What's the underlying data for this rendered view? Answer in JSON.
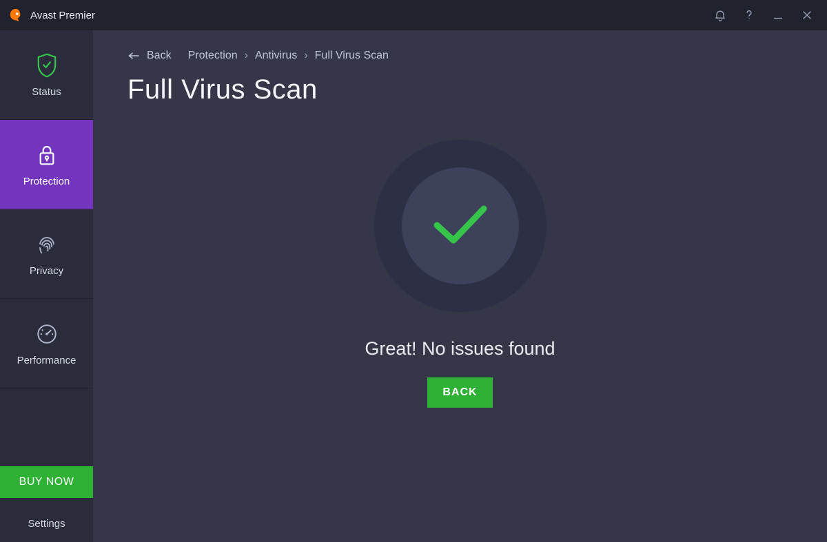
{
  "titlebar": {
    "app_name": "Avast Premier"
  },
  "sidebar": {
    "items": [
      {
        "label": "Status"
      },
      {
        "label": "Protection"
      },
      {
        "label": "Privacy"
      },
      {
        "label": "Performance"
      }
    ],
    "buy_now_label": "BUY NOW",
    "settings_label": "Settings"
  },
  "breadcrumb": {
    "back_label": "Back",
    "crumb1": "Protection",
    "crumb2": "Antivirus",
    "crumb3": "Full Virus Scan",
    "separator": "›"
  },
  "main": {
    "page_title": "Full Virus Scan",
    "result_text": "Great! No issues found",
    "back_button_label": "BACK"
  },
  "colors": {
    "accent_purple": "#7435be",
    "accent_green": "#2eb135",
    "check_green": "#36c44b"
  }
}
